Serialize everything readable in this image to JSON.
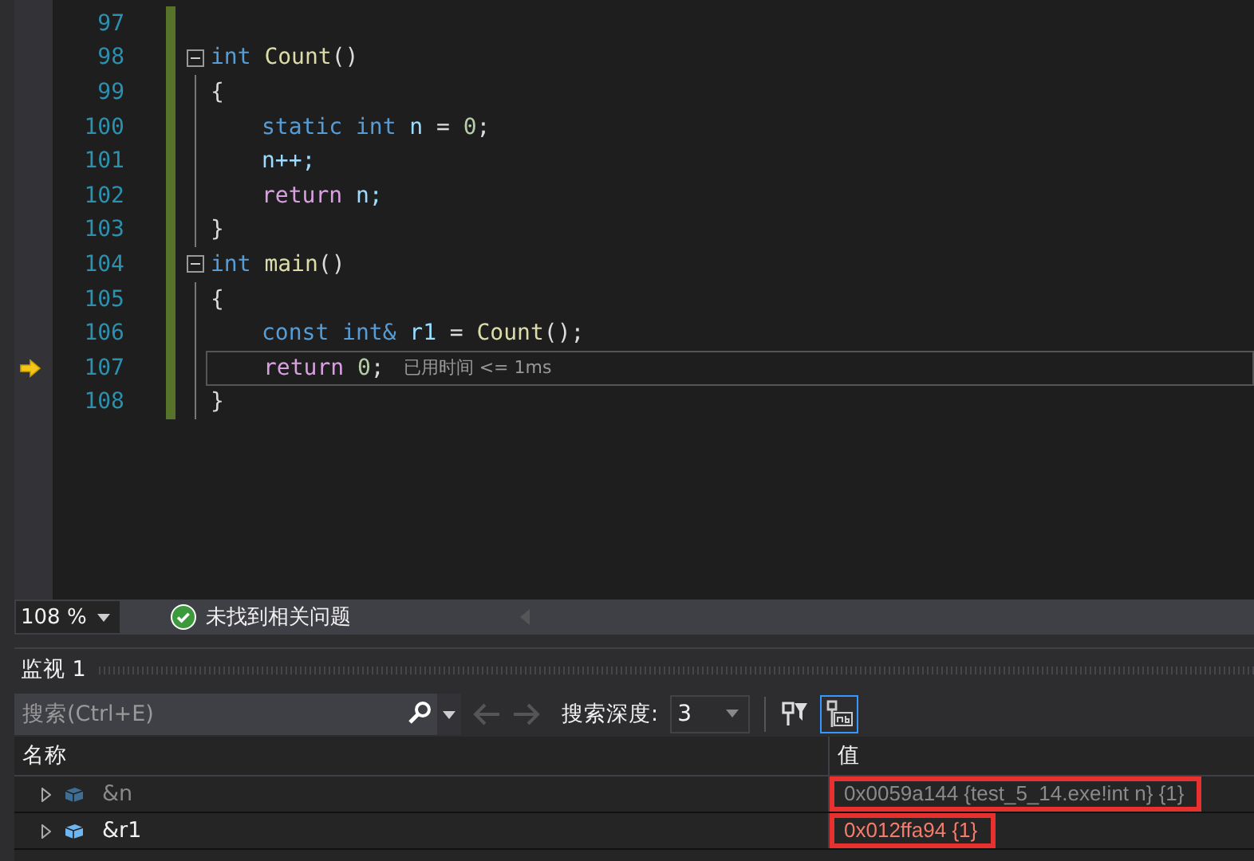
{
  "editor": {
    "lines": [
      {
        "number": "97",
        "kind": "blank",
        "current": false
      },
      {
        "number": "98",
        "kind": "fold-start",
        "current": false,
        "tokens": [
          {
            "kind": "kw",
            "text": "int"
          },
          {
            "kind": "fn",
            "text": "Count"
          },
          {
            "kind": "punct",
            "text": "()",
            "join": true
          }
        ]
      },
      {
        "number": "99",
        "kind": "brace",
        "current": false,
        "tokens": [
          {
            "kind": "punct",
            "text": "{"
          }
        ]
      },
      {
        "number": "100",
        "kind": "body",
        "current": false,
        "tokens": [
          {
            "kind": "kw",
            "text": "static"
          },
          {
            "kind": "kw",
            "text": "int"
          },
          {
            "kind": "var",
            "text": "n"
          },
          {
            "kind": "punct",
            "text": "="
          },
          {
            "kind": "num",
            "text": "0"
          },
          {
            "kind": "punct",
            "text": ";",
            "join": true
          }
        ]
      },
      {
        "number": "101",
        "kind": "body",
        "current": false,
        "tokens": [
          {
            "kind": "var",
            "text": "n++;"
          }
        ]
      },
      {
        "number": "102",
        "kind": "body",
        "current": false,
        "tokens": [
          {
            "kind": "ctl",
            "text": "return"
          },
          {
            "kind": "var",
            "text": "n;"
          }
        ]
      },
      {
        "number": "103",
        "kind": "brace",
        "current": false,
        "tokens": [
          {
            "kind": "punct",
            "text": "}"
          }
        ]
      },
      {
        "number": "104",
        "kind": "fold-start",
        "current": false,
        "tokens": [
          {
            "kind": "kw",
            "text": "int"
          },
          {
            "kind": "fn",
            "text": "main"
          },
          {
            "kind": "punct",
            "text": "()",
            "join": true
          }
        ]
      },
      {
        "number": "105",
        "kind": "brace",
        "current": false,
        "tokens": [
          {
            "kind": "punct",
            "text": "{"
          }
        ]
      },
      {
        "number": "106",
        "kind": "body",
        "current": false,
        "tokens": [
          {
            "kind": "kw",
            "text": "const"
          },
          {
            "kind": "kw",
            "text": "int&"
          },
          {
            "kind": "var",
            "text": "r1"
          },
          {
            "kind": "punct",
            "text": "="
          },
          {
            "kind": "fn",
            "text": "Count"
          },
          {
            "kind": "punct",
            "text": "();",
            "join": true
          }
        ]
      },
      {
        "number": "107",
        "kind": "body",
        "current": true,
        "elapsed": "已用时间 <= 1ms",
        "tokens": [
          {
            "kind": "ctl",
            "text": "return"
          },
          {
            "kind": "num",
            "text": "0"
          },
          {
            "kind": "punct",
            "text": ";",
            "join": true
          }
        ]
      },
      {
        "number": "108",
        "kind": "brace",
        "current": false,
        "tokens": [
          {
            "kind": "punct",
            "text": "}"
          }
        ]
      }
    ]
  },
  "status": {
    "zoom": "108 %",
    "message": "未找到相关问题"
  },
  "watch": {
    "title": "监视 1",
    "search": {
      "placeholder": "搜索(Ctrl+E)"
    },
    "depth_label": "搜索深度:",
    "depth": "3",
    "columns": [
      "名称",
      "值"
    ],
    "rows": [
      {
        "name": "&n",
        "value": "0x0059a144 {test_5_14.exe!int n} {1}",
        "stale": true,
        "changed": false,
        "highlighted": true
      },
      {
        "name": "&r1",
        "value": "0x012ffa94 {1}",
        "stale": false,
        "changed": true,
        "highlighted": true
      }
    ]
  }
}
